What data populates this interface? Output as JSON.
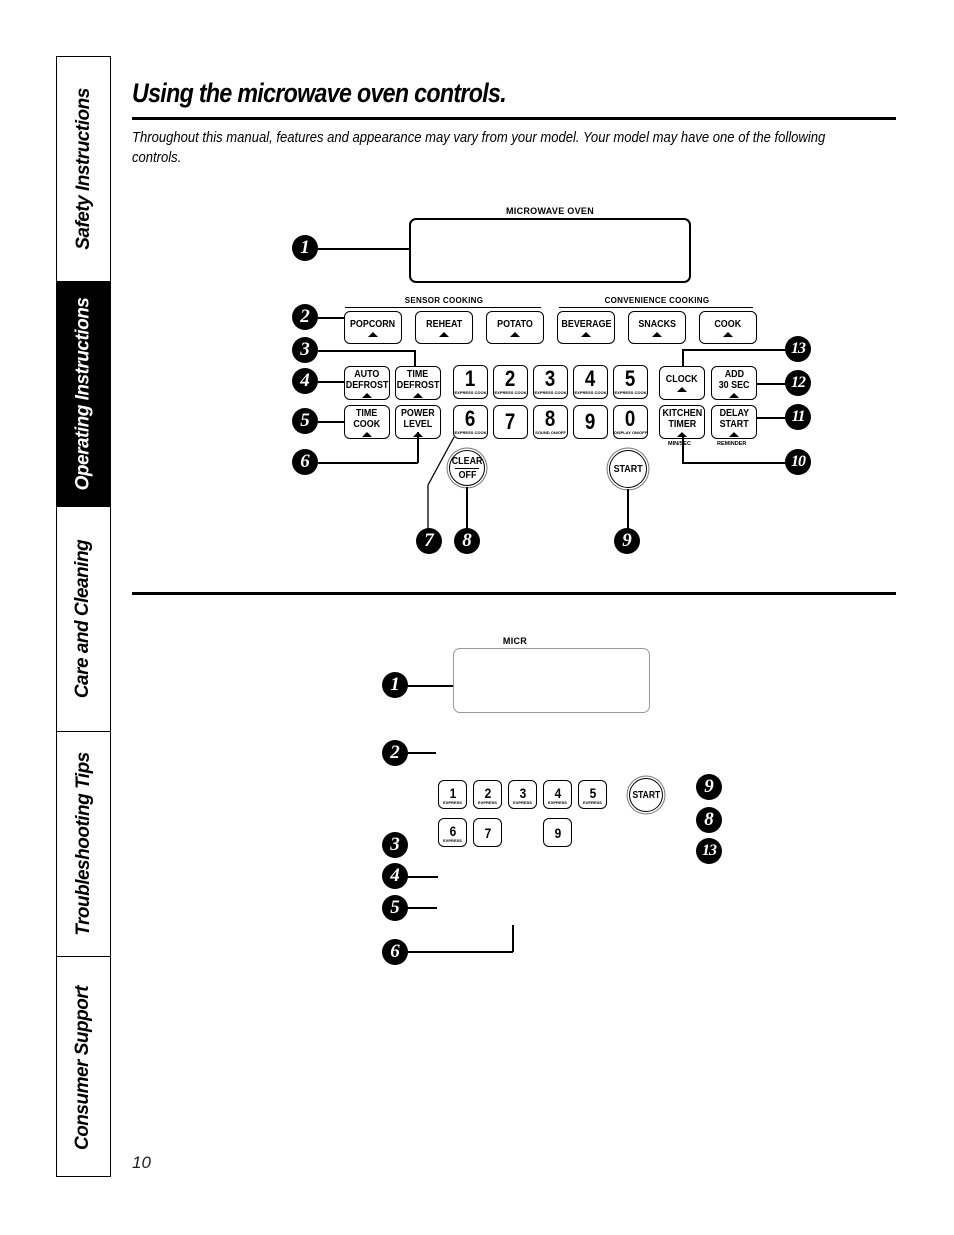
{
  "sidebar": {
    "tabs": [
      {
        "label": "Safety Instructions",
        "active": false
      },
      {
        "label": "Operating Instructions",
        "active": true
      },
      {
        "label": "Care and Cleaning",
        "active": false
      },
      {
        "label": "Troubleshooting Tips",
        "active": false
      },
      {
        "label": "Consumer Support",
        "active": false
      }
    ]
  },
  "header": {
    "title": "Using the microwave oven controls.",
    "intro": "Throughout this manual, features and appearance may vary from your model. Your model may have one of the following controls."
  },
  "panel1": {
    "display_label": "MICROWAVE OVEN",
    "sensor_label": "SENSOR COOKING",
    "convenience_label": "CONVENIENCE COOKING",
    "sensor_buttons": [
      "POPCORN",
      "REHEAT",
      "POTATO"
    ],
    "convenience_buttons": [
      "BEVERAGE",
      "SNACKS",
      "COOK"
    ],
    "auto_defrost": [
      "AUTO",
      "DEFROST"
    ],
    "time_defrost": [
      "TIME",
      "DEFROST"
    ],
    "time_cook": [
      "TIME",
      "COOK"
    ],
    "power_level": [
      "POWER",
      "LEVEL"
    ],
    "keypad": [
      {
        "digit": "1",
        "sub": "EXPRESS COOK"
      },
      {
        "digit": "2",
        "sub": "EXPRESS COOK"
      },
      {
        "digit": "3",
        "sub": "EXPRESS COOK"
      },
      {
        "digit": "4",
        "sub": "EXPRESS COOK"
      },
      {
        "digit": "5",
        "sub": "EXPRESS COOK"
      },
      {
        "digit": "6",
        "sub": "EXPRESS COOK"
      },
      {
        "digit": "7",
        "sub": ""
      },
      {
        "digit": "8",
        "sub": "SOUND ON/OFF"
      },
      {
        "digit": "9",
        "sub": ""
      },
      {
        "digit": "0",
        "sub": "DISPLAY ON/OFF"
      }
    ],
    "clock": "CLOCK",
    "add30": [
      "ADD",
      "30 SEC"
    ],
    "kitchen_timer": [
      "KITCHEN",
      "TIMER"
    ],
    "kitchen_timer_sub": "MIN/SEC",
    "delay_start": [
      "DELAY",
      "START"
    ],
    "delay_start_sub": "REMINDER",
    "clear_off": [
      "CLEAR",
      "OFF"
    ],
    "start": "START",
    "callouts": [
      "1",
      "2",
      "3",
      "4",
      "5",
      "6",
      "7",
      "8",
      "9",
      "10",
      "11",
      "12",
      "13"
    ]
  },
  "panel2": {
    "display_label": "MICR",
    "keypad": [
      {
        "digit": "1",
        "sub": "EXPRESS"
      },
      {
        "digit": "2",
        "sub": "EXPRESS"
      },
      {
        "digit": "3",
        "sub": "EXPRESS"
      },
      {
        "digit": "4",
        "sub": "EXPRESS"
      },
      {
        "digit": "5",
        "sub": "EXPRESS"
      },
      {
        "digit": "6",
        "sub": "EXPRESS"
      },
      {
        "digit": "7",
        "sub": ""
      },
      {
        "digit": "9",
        "sub": ""
      }
    ],
    "start": "START",
    "callouts_left": [
      "1",
      "2",
      "3",
      "4",
      "5",
      "6"
    ],
    "callouts_right": [
      "9",
      "8",
      "13"
    ]
  },
  "footer": {
    "page_number": "10"
  }
}
